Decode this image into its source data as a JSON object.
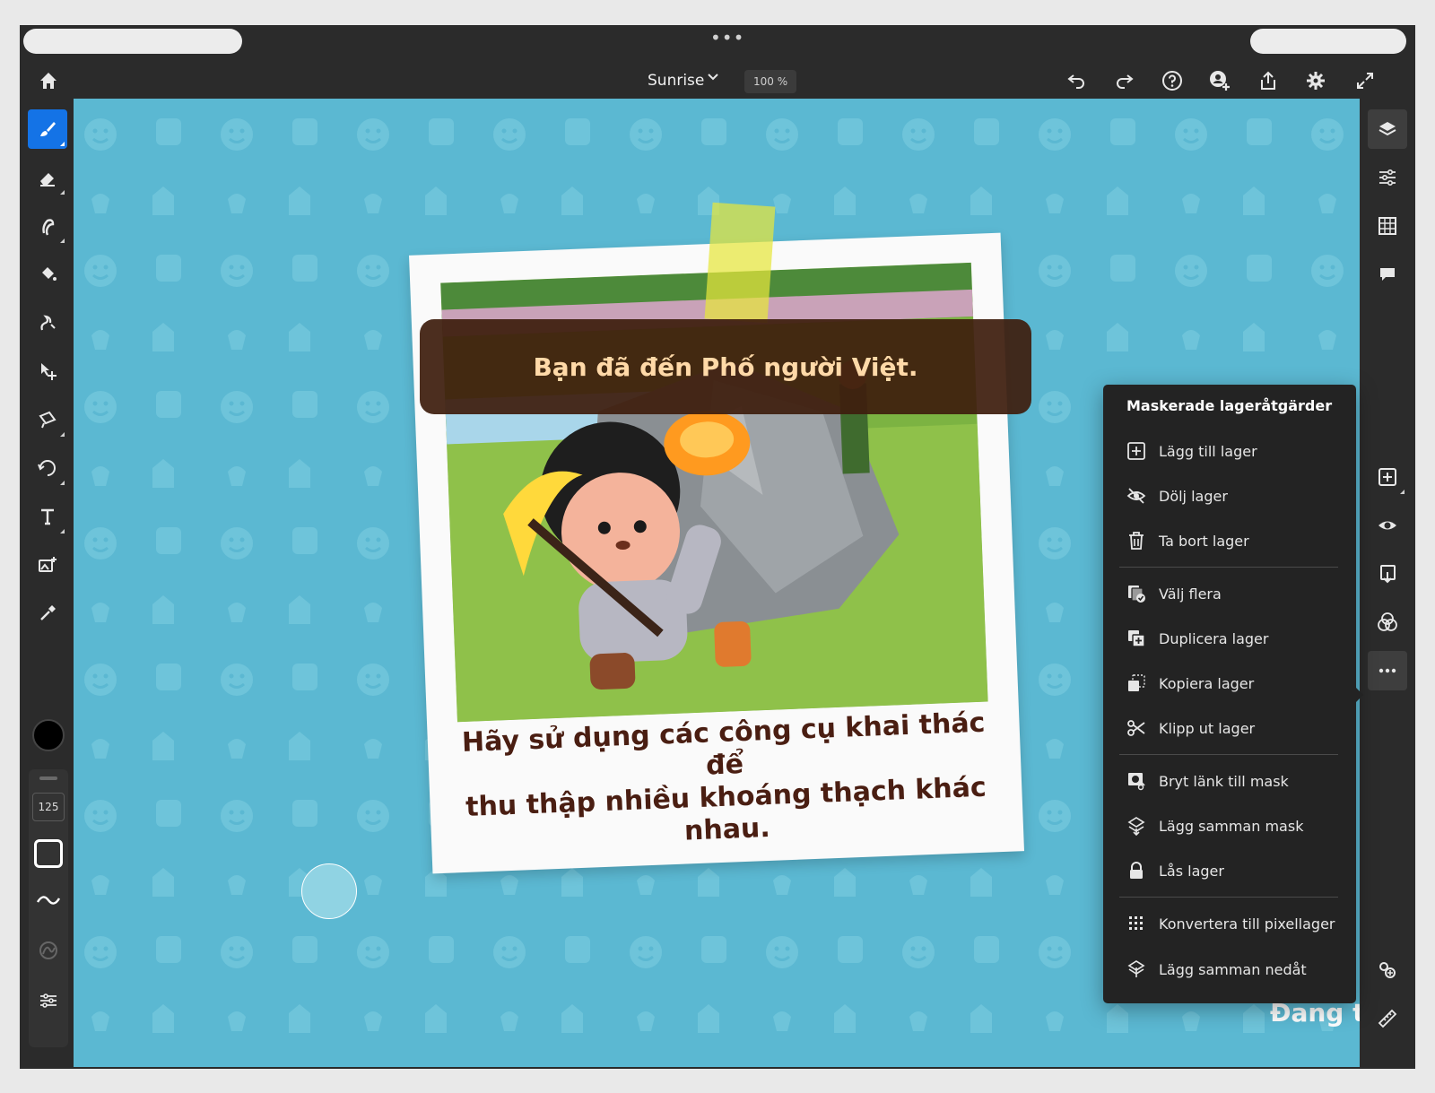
{
  "topbar": {
    "document_title": "Sunrise",
    "zoom": "100 %",
    "multitask_dots": "•••"
  },
  "left_toolbar": {
    "brush_size": "125",
    "active_color": "#000000",
    "tools": [
      "brush-tool",
      "eraser-tool",
      "smudge-tool",
      "fill-tool",
      "healing-tool",
      "move-tool",
      "lasso-tool",
      "transform-tool",
      "text-tool",
      "place-image-tool",
      "eyedropper-tool"
    ]
  },
  "canvas": {
    "banner_text": "Bạn đã đến Phố người Việt.",
    "caption_line1": "Hãy sử dụng các công cụ khai thác để",
    "caption_line2": "thu thập nhiều khoáng thạch khác nhau.",
    "bottom_partial_text": "Đang tả",
    "background_color": "#5bb8d2"
  },
  "menu": {
    "title": "Maskerade lageråtgärder",
    "groups": [
      [
        {
          "label": "Lägg till lager",
          "icon": "add-layer-icon"
        },
        {
          "label": "Dölj lager",
          "icon": "hide-layer-icon"
        },
        {
          "label": "Ta bort lager",
          "icon": "trash-icon"
        }
      ],
      [
        {
          "label": "Välj flera",
          "icon": "select-multiple-icon"
        },
        {
          "label": "Duplicera lager",
          "icon": "duplicate-layer-icon"
        },
        {
          "label": "Kopiera lager",
          "icon": "copy-layer-icon"
        },
        {
          "label": "Klipp ut lager",
          "icon": "cut-icon"
        }
      ],
      [
        {
          "label": "Bryt länk till mask",
          "icon": "unlink-mask-icon"
        },
        {
          "label": "Lägg samman mask",
          "icon": "merge-mask-icon"
        },
        {
          "label": "Lås lager",
          "icon": "lock-icon"
        }
      ],
      [
        {
          "label": "Konvertera till pixellager",
          "icon": "pixel-layer-icon"
        },
        {
          "label": "Lägg samman nedåt",
          "icon": "merge-down-icon"
        }
      ]
    ]
  },
  "colors": {
    "accent": "#1473e6",
    "app_background": "#2b2b2b",
    "menu_background": "#232323"
  }
}
